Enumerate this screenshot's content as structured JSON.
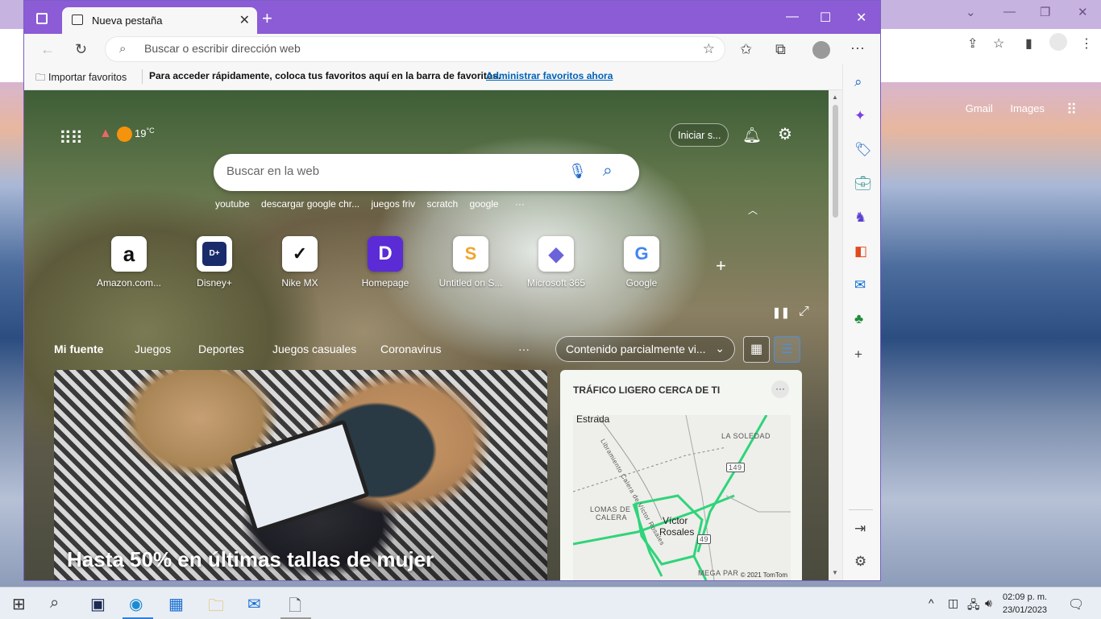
{
  "background_window": {
    "links": [
      "Gmail",
      "Images"
    ]
  },
  "browser": {
    "tab_title": "Nueva pestaña",
    "address_placeholder": "Buscar o escribir dirección web",
    "favorites_import": "Importar favoritos",
    "favorites_hint": "Para acceder rápidamente, coloca tus favoritos aquí en la barra de favoritos.",
    "favorites_manage": "Administrar favoritos ahora"
  },
  "newtab": {
    "temperature": "19",
    "temperature_unit": "°C",
    "signin_label": "Iniciar s...",
    "search_placeholder": "Buscar en la web",
    "trending": [
      "youtube",
      "descargar google chr...",
      "juegos friv",
      "scratch",
      "google"
    ],
    "more": "···",
    "tiles": [
      {
        "label": "Amazon.com...",
        "glyph": "a",
        "color": "#111111"
      },
      {
        "label": "Disney+",
        "glyph": "D+",
        "color": "#1a2b6b"
      },
      {
        "label": "Nike MX",
        "glyph": "✓",
        "color": "#111111"
      },
      {
        "label": "Homepage",
        "glyph": "D",
        "color": "#5b2bd6"
      },
      {
        "label": "Untitled on S...",
        "glyph": "S",
        "color": "#f1a52d"
      },
      {
        "label": "Microsoft 365",
        "glyph": "◆",
        "color": "#6b63d9"
      },
      {
        "label": "Google",
        "glyph": "G",
        "color": "#4285f4"
      }
    ],
    "feed_nav": [
      "Mi fuente",
      "Juegos",
      "Deportes",
      "Juegos casuales",
      "Coronavirus"
    ],
    "content_dropdown": "Contenido parcialmente vi...",
    "main_card_title": "Hasta 50% en últimas tallas de mujer",
    "traffic_title": "TRÁFICO LIGERO CERCA DE TI",
    "map_labels": {
      "estrada": "Estrada",
      "soledad": "LA SOLEDAD",
      "lomas": "LOMAS DE",
      "lomas2": "CALERA",
      "city1": "Víctor",
      "city2": "Rosales",
      "mega": "MEGA PAR",
      "road_149": "149",
      "road_49": "49",
      "street1": "Libramiento Calera de Víctor Rosales",
      "copyright": "© 2021 TomTom"
    }
  },
  "taskbar": {
    "time": "02:09 p. m.",
    "date": "23/01/2023"
  }
}
